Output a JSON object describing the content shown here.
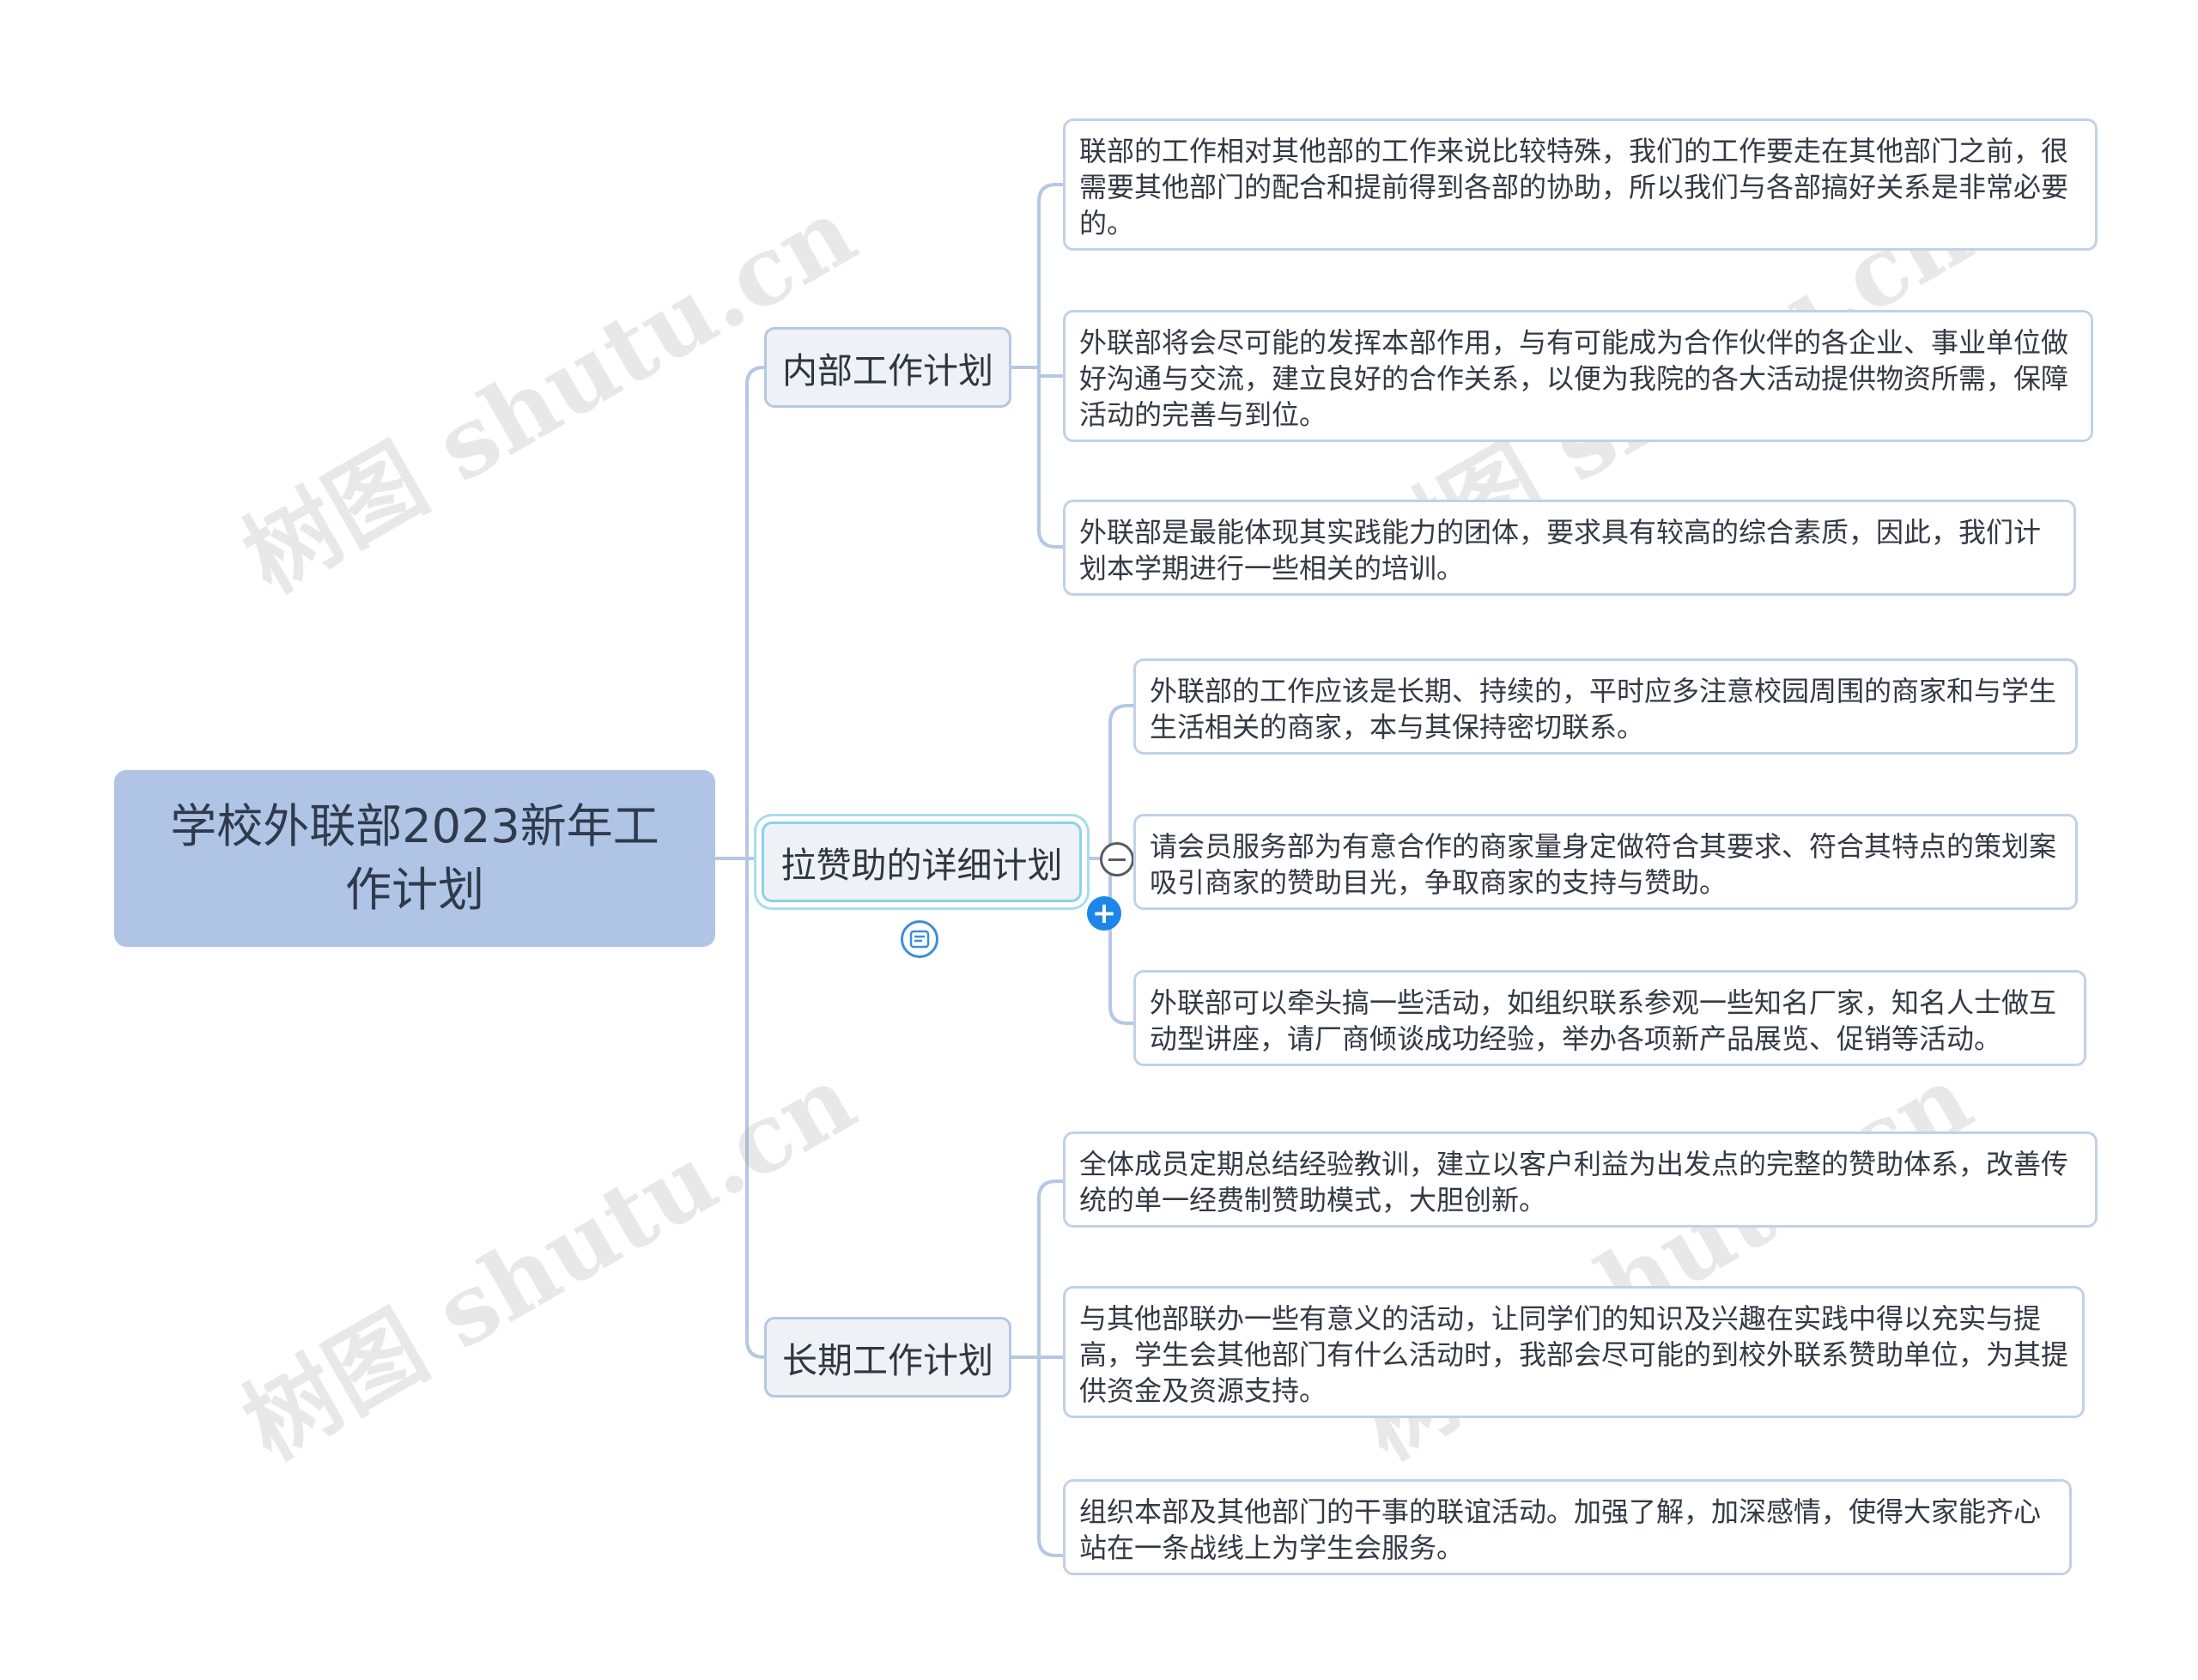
{
  "root": {
    "title": "学校外联部2023新年工作计划"
  },
  "branches": [
    {
      "label": "内部工作计划",
      "leaves": [
        "联部的工作相对其他部的工作来说比较特殊，我们的工作要走在其他部门之前，很需要其他部门的配合和提前得到各部的协助，所以我们与各部搞好关系是非常必要的。",
        "外联部将会尽可能的发挥本部作用，与有可能成为合作伙伴的各企业、事业单位做好沟通与交流，建立良好的合作关系，以便为我院的各大活动提供物资所需，保障活动的完善与到位。",
        "外联部是最能体现其实践能力的团体，要求具有较高的综合素质，因此，我们计划本学期进行一些相关的培训。"
      ]
    },
    {
      "label": "拉赞助的详细计划",
      "leaves": [
        "外联部的工作应该是长期、持续的，平时应多注意校园周围的商家和与学生生活相关的商家，本与其保持密切联系。",
        "请会员服务部为有意合作的商家量身定做符合其要求、符合其特点的策划案吸引商家的赞助目光，争取商家的支持与赞助。",
        "外联部可以牵头搞一些活动，如组织联系参观一些知名厂家，知名人士做互动型讲座，请厂商倾谈成功经验，举办各项新产品展览、促销等活动。"
      ]
    },
    {
      "label": "长期工作计划",
      "leaves": [
        "全体成员定期总结经验教训，建立以客户利益为出发点的完整的赞助体系，改善传统的单一经费制赞助模式，大胆创新。",
        "与其他部联办一些有意义的活动，让同学们的知识及兴趣在实践中得以充实与提高，学生会其他部门有什么活动时，我部会尽可能的到校外联系赞助单位，为其提供资金及资源支持。",
        "组织本部及其他部门的干事的联谊活动。加强了解，加深感情，使得大家能齐心站在一条战线上为学生会服务。"
      ]
    }
  ],
  "watermark": "树图 shutu.cn",
  "colors": {
    "root": "#b0c4e6",
    "line": "#b5c8e3",
    "accent": "#1d86e8"
  },
  "icons": [
    "collapse-icon",
    "add-icon",
    "note-icon"
  ]
}
